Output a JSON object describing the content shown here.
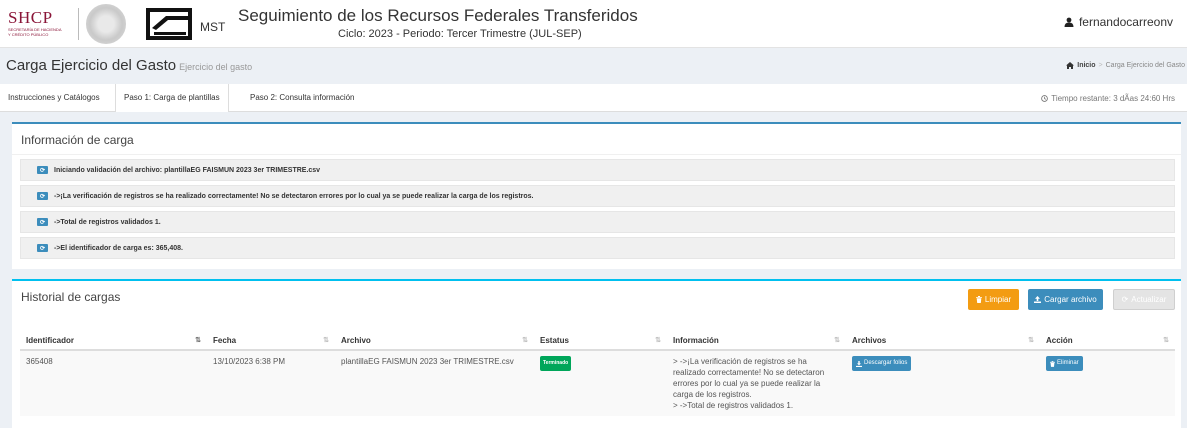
{
  "header": {
    "logo_shcp": "SHCP",
    "logo_shcp_sub1": "SECRETARÍA DE HACIENDA",
    "logo_shcp_sub2": "Y CRÉDITO PÚBLICO",
    "mst": "MST",
    "title": "Seguimiento de los Recursos Federales Transferidos",
    "subtitle": "Ciclo: 2023 - Periodo: Tercer Trimestre (JUL-SEP)",
    "user": "fernandocarreonv"
  },
  "page": {
    "title": "Carga Ejercicio del Gasto",
    "subtitle": "Ejercicio del gasto",
    "breadcrumb_home": "Inicio",
    "breadcrumb_current": "Carga Ejercicio del Gasto"
  },
  "tabs": [
    {
      "label": "Instrucciones y Catálogos"
    },
    {
      "label": "Paso 1: Carga de plantillas"
    },
    {
      "label": "Paso 2: Consulta información"
    }
  ],
  "timer": "Tiempo restante: 3 dÃ­as 24:60 Hrs",
  "carga": {
    "title": "Información de carga",
    "log": [
      "Iniciando validación del archivo: plantillaEG FAISMUN 2023 3er TRIMESTRE.csv",
      "->¡La verificación de registros se ha realizado correctamente! No se detectaron errores por lo cual ya se puede realizar la carga de los registros.",
      "->Total de registros validados 1.",
      "->El identificador de carga es: 365,408."
    ]
  },
  "historial": {
    "title": "Historial de cargas",
    "btn_limpiar": "Limpiar",
    "btn_cargar": "Cargar archivo",
    "btn_actualizar": "Actualizar",
    "columns": [
      "Identificador",
      "Fecha",
      "Archivo",
      "Estatus",
      "Información",
      "Archivos",
      "Acción"
    ],
    "rows": [
      {
        "id": "365408",
        "fecha": "13/10/2023 6:38 PM",
        "archivo": "plantillaEG FAISMUN 2023 3er TRIMESTRE.csv",
        "estatus": "Terminado",
        "info1": "> ->¡La verificación de registros se ha realizado correctamente! No se detectaron errores por lo cual ya se puede realizar la carga de los registros.",
        "info2": "> ->Total de registros validados 1.",
        "archivos_btn": "Descargar folios",
        "accion_btn": "Eliminar"
      }
    ]
  },
  "colors": {
    "primary": "#3c8dbc",
    "warning": "#f39c12",
    "success": "#00a65a",
    "info": "#00c0ef",
    "brand": "#8a1538"
  }
}
